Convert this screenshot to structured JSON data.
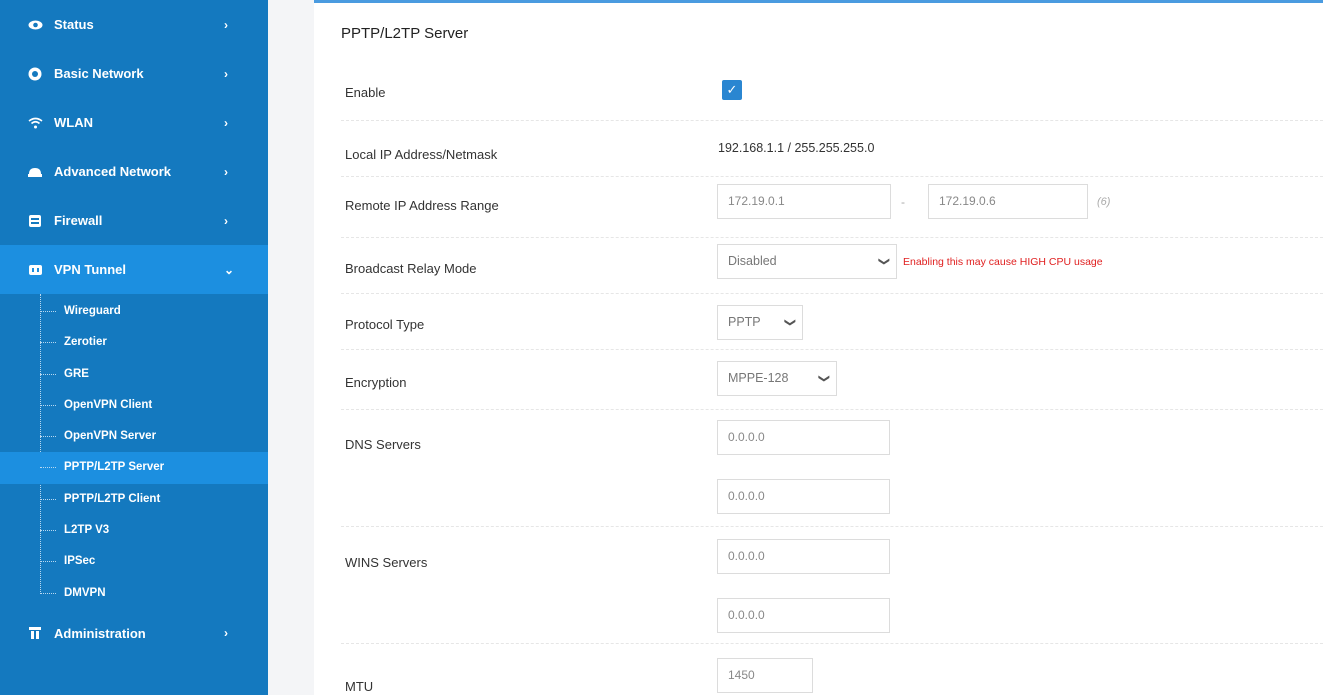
{
  "sidebar": {
    "items": [
      {
        "label": "Status",
        "icon": "eye-icon",
        "arrow": "›"
      },
      {
        "label": "Basic Network",
        "icon": "globe-icon",
        "arrow": "›"
      },
      {
        "label": "WLAN",
        "icon": "wifi-icon",
        "arrow": "›"
      },
      {
        "label": "Advanced Network",
        "icon": "cloud-network-icon",
        "arrow": "›"
      },
      {
        "label": "Firewall",
        "icon": "firewall-icon",
        "arrow": "›"
      },
      {
        "label": "VPN Tunnel",
        "icon": "vpn-icon",
        "arrow": "⌄"
      }
    ],
    "vpn_sub": [
      "Wireguard",
      "Zerotier",
      "GRE",
      "OpenVPN Client",
      "OpenVPN Server",
      "PPTP/L2TP Server",
      "PPTP/L2TP Client",
      "L2TP V3",
      "IPSec",
      "DMVPN"
    ],
    "admin": {
      "label": "Administration",
      "icon": "admin-icon",
      "arrow": "›"
    }
  },
  "main": {
    "title": "PPTP/L2TP Server",
    "fields": {
      "enable_label": "Enable",
      "enable_checked": true,
      "local_ip_label": "Local IP Address/Netmask",
      "local_ip_value": "192.168.1.1 / 255.255.255.0",
      "remote_range_label": "Remote IP Address Range",
      "remote_start": "172.19.0.1",
      "remote_end": "172.19.0.6",
      "remote_dash": "-",
      "remote_count": "(6)",
      "broadcast_label": "Broadcast Relay Mode",
      "broadcast_value": "Disabled",
      "broadcast_warning": "Enabling this may cause HIGH CPU usage",
      "protocol_label": "Protocol Type",
      "protocol_value": "PPTP",
      "encryption_label": "Encryption",
      "encryption_value": "MPPE-128",
      "dns_label": "DNS Servers",
      "dns1": "0.0.0.0",
      "dns2": "0.0.0.0",
      "wins_label": "WINS Servers",
      "wins1": "0.0.0.0",
      "wins2": "0.0.0.0",
      "mtu_label": "MTU",
      "mtu_value": "1450"
    }
  },
  "colors": {
    "sidebar": "#1479bf",
    "active": "#1c8fe0",
    "warning": "#e02020",
    "checkbox": "#2a86d1"
  }
}
